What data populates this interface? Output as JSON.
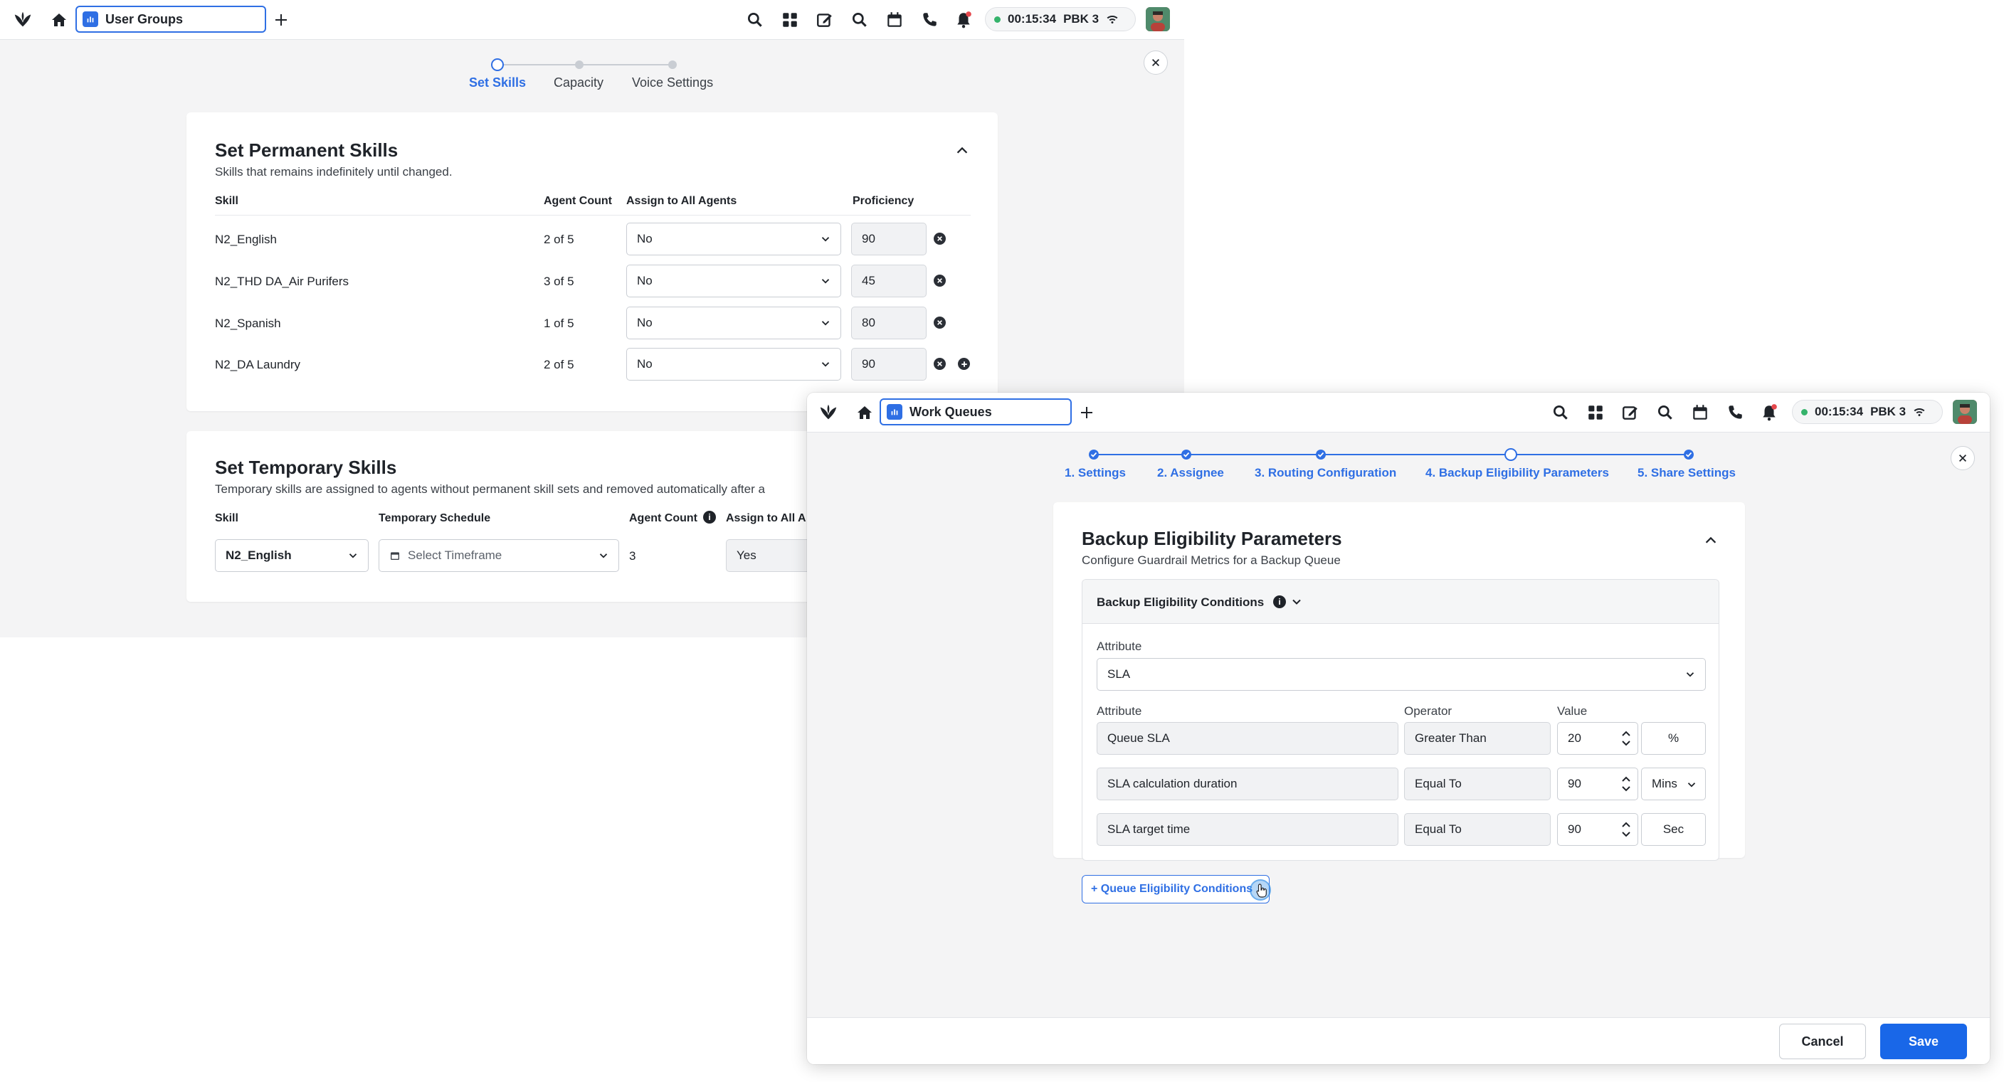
{
  "window1": {
    "tab_title": "User Groups",
    "timer": "00:15:34",
    "extension": "PBK 3",
    "steps": [
      "Set Skills",
      "Capacity",
      "Voice Settings"
    ],
    "permanent": {
      "title": "Set Permanent Skills",
      "subtitle": "Skills that remains indefinitely until changed.",
      "headers": {
        "skill": "Skill",
        "agent_count": "Agent Count",
        "assign_all": "Assign to All Agents",
        "proficiency": "Proficiency"
      },
      "rows": [
        {
          "skill": "N2_English",
          "count": "2 of 5",
          "assign": "No",
          "proficiency": "90"
        },
        {
          "skill": "N2_THD DA_Air Purifers",
          "count": "3 of 5",
          "assign": "No",
          "proficiency": "45"
        },
        {
          "skill": "N2_Spanish",
          "count": "1 of 5",
          "assign": "No",
          "proficiency": "80"
        },
        {
          "skill": "N2_DA Laundry",
          "count": "2 of 5",
          "assign": "No",
          "proficiency": "90"
        }
      ]
    },
    "temporary": {
      "title": "Set Temporary Skills",
      "subtitle": "Temporary skills are assigned to agents without permanent skill sets and removed automatically after a",
      "headers": {
        "skill": "Skill",
        "schedule": "Temporary Schedule",
        "agent_count": "Agent Count",
        "assign_all": "Assign to All A"
      },
      "row": {
        "skill": "N2_English",
        "schedule_placeholder": "Select Timeframe",
        "count": "3",
        "assign": "Yes"
      }
    }
  },
  "window2": {
    "tab_title": "Work Queues",
    "timer": "00:15:34",
    "extension": "PBK 3",
    "steps": [
      "1. Settings",
      "2. Assignee",
      "3. Routing Configuration",
      "4. Backup Eligibility Parameters",
      "5. Share Settings"
    ],
    "card": {
      "title": "Backup Eligibility Parameters",
      "subtitle": "Configure Guardrail Metrics for a Backup Queue",
      "section_title": "Backup Eligibility Conditions",
      "attribute_label": "Attribute",
      "attribute_value": "SLA",
      "col_attribute": "Attribute",
      "col_operator": "Operator",
      "col_value": "Value",
      "conditions": [
        {
          "attribute": "Queue SLA",
          "operator": "Greater Than",
          "value": "20",
          "unit": "%"
        },
        {
          "attribute": "SLA calculation duration",
          "operator": "Equal To",
          "value": "90",
          "unit": "Mins"
        },
        {
          "attribute": "SLA target time",
          "operator": "Equal To",
          "value": "90",
          "unit": "Sec"
        }
      ],
      "add_button": "+ Queue Eligibility Conditions"
    },
    "footer": {
      "cancel": "Cancel",
      "save": "Save"
    }
  },
  "colors": {
    "accent": "#2f6fe4",
    "primary_button": "#1967e8",
    "status_green": "#35b36b",
    "notification": "#e5484d"
  }
}
